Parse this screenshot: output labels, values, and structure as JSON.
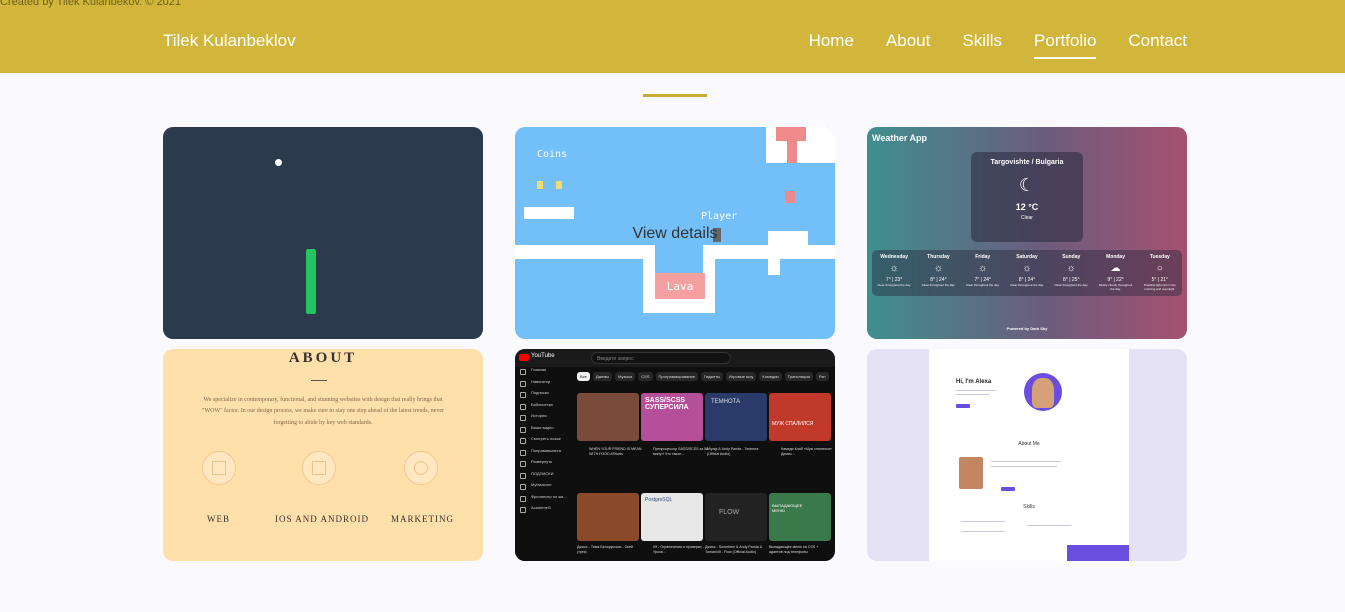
{
  "credit": "Created by Tilek Kulanbekov. © 2021",
  "header": {
    "brand": "Tilek Kulanbeklov",
    "nav": [
      {
        "label": "Home"
      },
      {
        "label": "About"
      },
      {
        "label": "Skills"
      },
      {
        "label": "Portfolio",
        "active": true
      },
      {
        "label": "Contact"
      }
    ]
  },
  "colors": {
    "header_bg": "#d2b63b",
    "accent_line": "#c8ae38",
    "page_bg": "#fafafe"
  },
  "portfolio": {
    "card2": {
      "coins_label": "Coins",
      "player_label": "Player",
      "lava_label": "Lava",
      "overlay": "View details"
    },
    "card3": {
      "app_title": "Weather App",
      "city": "Targovishte / Bulgaria",
      "temp": "12 °C",
      "condition": "Clear",
      "days": [
        {
          "name": "Wednesday",
          "temp": "7° | 23°",
          "desc": "Clear throughout the day."
        },
        {
          "name": "Thursday",
          "temp": "8° | 24°",
          "desc": "Clear throughout the day."
        },
        {
          "name": "Friday",
          "temp": "7° | 24°",
          "desc": "Clear throughout the day."
        },
        {
          "name": "Saturday",
          "temp": "8° | 24°",
          "desc": "Clear throughout the day."
        },
        {
          "name": "Sunday",
          "temp": "8° | 25°",
          "desc": "Clear throughout the day."
        },
        {
          "name": "Monday",
          "temp": "9° | 22°",
          "desc": "Mostly cloudy throughout the day."
        },
        {
          "name": "Tuesday",
          "temp": "5° | 21°",
          "desc": "Possible light rain in the morning and overnight."
        }
      ],
      "footer": "Powered by Dark Sky"
    },
    "card4": {
      "title": "ABOUT",
      "text": "We specialize in contemporary, functional, and stunning websites with design that really brings that \"WOW\" factor. In our design process, we make sure to stay one step ahead of the latest trends, never forgetting to abide by key web standards.",
      "services": [
        "WEB",
        "IOS AND ANDROID",
        "MARKETING"
      ]
    },
    "card5": {
      "logo": "YouTube",
      "search_placeholder": "Введите запрос",
      "sidebar": [
        "Главная",
        "Навигатор",
        "Подписки",
        "Библиотека",
        "История",
        "Ваши видео",
        "Смотреть позже",
        "Понравившиеся",
        "Развернуть",
        "ПОДПИСКИ",
        "Myfasacom",
        "Фрилансер по жи...",
        "AcademeG"
      ],
      "chips": [
        "Все",
        "Джемы",
        "Музыка",
        "CSS",
        "Программирование",
        "Гаджеты",
        "Игровые шоу",
        "Комедии",
        "Трансляции",
        "Рэп",
        "Ки"
      ],
      "videos": [
        {
          "title": "WHEN YOUR FRIEND IS MEAN WITH FOOD #Shorts",
          "color": "#7a4b3a"
        },
        {
          "title": "Препроцессор SASS/SCSS за 58 минут! Что такое...",
          "thumb_text": "SASS/SCSS СУПЕРСИЛА",
          "color": "#b64f9a"
        },
        {
          "title": "Miyagi & Andy Panda - Темнота (Official Audio)",
          "thumb_text": "ТЕМНОТА",
          "color": "#2a3a6a"
        },
        {
          "title": "Камеди Клаб «Муж спалился» Демис...",
          "thumb_text": "МУЖ СПАЛИЛСЯ",
          "color": "#c0392b"
        },
        {
          "title": "Джиос - Тима Белорусских - Окей (трек)",
          "color": "#8a4a2a"
        },
        {
          "title": "09 - Ограничения и проверки - Уроки...",
          "thumb_text": "PostgreSQL",
          "color": "#e8e8e8"
        },
        {
          "title": "Джиос - Sometime & Andy Panda & Tumani49 - Flow (Official Audio)",
          "thumb_text": "FLOW",
          "color": "#222222"
        },
        {
          "title": "Выпадающее меню на CSS + адаптив под телефоны",
          "thumb_text": "ВЫПАДАЮЩЕЕ МЕНЮ",
          "color": "#3a7a4a"
        }
      ]
    },
    "card6": {
      "greeting": "Hi, I'm Alexa",
      "about": "About Me",
      "skills": "Skills"
    }
  }
}
